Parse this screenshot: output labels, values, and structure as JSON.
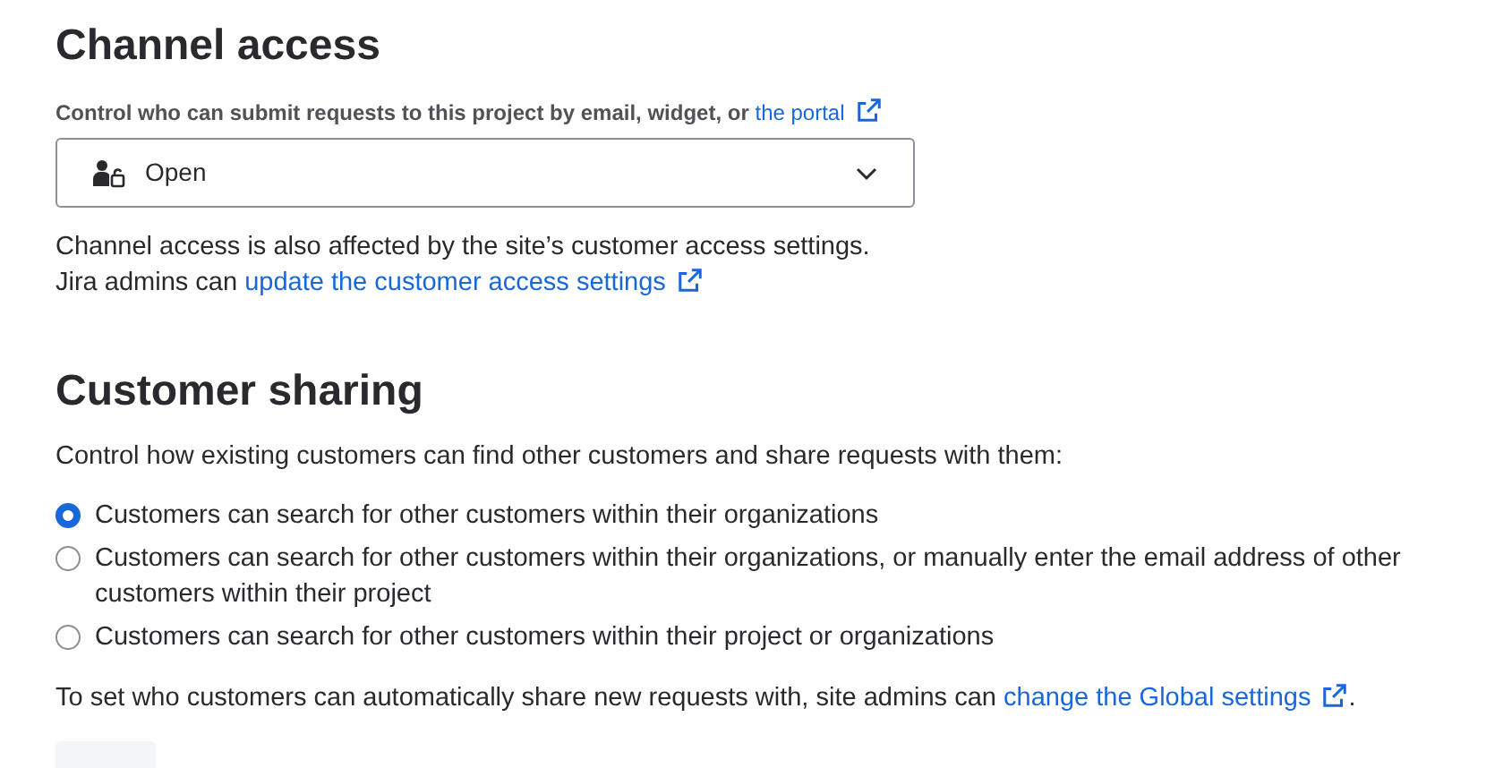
{
  "channel_access": {
    "title": "Channel access",
    "description": "Control who can submit requests to this project by email, widget, or",
    "description_link": "the portal",
    "select": {
      "value": "Open"
    },
    "note_lines": [
      "Channel access is also affected by the site’s customer access settings."
    ],
    "note_prefix": "Jira admins can",
    "note_link": "update the customer access settings"
  },
  "customer_sharing": {
    "title": "Customer sharing",
    "description": "Control how existing customers can find other customers and share requests with them:",
    "options": [
      {
        "label": "Customers can search for other customers within their organizations",
        "selected": true
      },
      {
        "label": "Customers can search for other customers within their organizations, or manually enter the email address of other customers within their project",
        "selected": false
      },
      {
        "label": "Customers can search for other customers within their project or organizations",
        "selected": false
      }
    ],
    "footer_prefix": "To set who customers can automatically share new requests with, site admins can",
    "footer_link": "change the Global settings",
    "footer_suffix": "."
  }
}
